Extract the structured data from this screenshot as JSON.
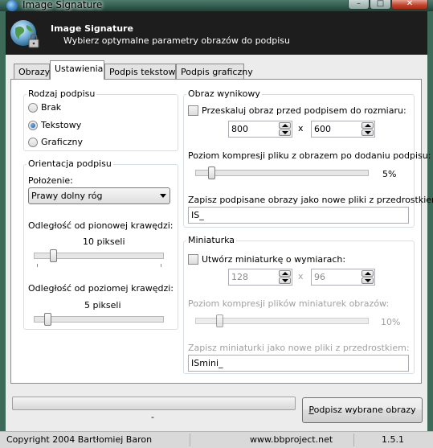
{
  "window": {
    "title": "Image Signature",
    "minimize_glyph": "–",
    "maximize_glyph": "□",
    "close_glyph": "✕"
  },
  "header": {
    "title": "Image Signature",
    "subtitle": "Wybierz optymalne parametry obrazów do podpisu",
    "logo_icon": "globe-lock-icon"
  },
  "tabs": [
    {
      "label": "Obrazy",
      "active": false
    },
    {
      "label": "Ustawienia",
      "active": true
    },
    {
      "label": "Podpis tekstowy",
      "active": false
    },
    {
      "label": "Podpis graficzny",
      "active": false
    }
  ],
  "signature_type": {
    "legend": "Rodzaj podpisu",
    "options": [
      "Brak",
      "Tekstowy",
      "Graficzny"
    ],
    "selected": "Tekstowy"
  },
  "orientation": {
    "legend": "Orientacja podpisu",
    "position_label": "Położenie:",
    "position_value": "Prawy dolny róg",
    "vertical_label": "Odległość od pionowej krawędzi:",
    "vertical_value": "10 pikseli",
    "vertical_level": 0.1,
    "horizontal_label": "Odległość od poziomej krawędzi:",
    "horizontal_value": "5 pikseli",
    "horizontal_level": 0.05
  },
  "output_image": {
    "legend": "Obraz wynikowy",
    "resize_label": "Przeskaluj obraz przed podpisem do rozmiaru:",
    "resize_checked": false,
    "width": "800",
    "x_separator": "x",
    "height": "600",
    "compression_label": "Poziom kompresji pliku z obrazem po dodaniu podpisu:",
    "compression_value": "5%",
    "compression_level": 0.05,
    "prefix_label": "Zapisz podpisane obrazy jako nowe pliki z przedrostkiem:",
    "prefix_value": "IS_"
  },
  "thumbnail": {
    "legend": "Miniaturka",
    "create_label": "Utwórz miniaturkę o wymiarach:",
    "create_checked": false,
    "width": "128",
    "x_separator": "x",
    "height": "96",
    "compression_label": "Poziom kompresji plików miniaturek obrazów:",
    "compression_value": "10%",
    "compression_level": 0.1,
    "prefix_label": "Zapisz miniaturki jako nowe pliki z przedrostkiem:",
    "prefix_value": "ISmini_"
  },
  "progress": {
    "status_text": "-",
    "level": 0
  },
  "sign_button": {
    "label_accel": "P",
    "label_rest": "odpisz wybrane obrazy"
  },
  "statusbar": {
    "copyright": "Copyright 2004 Bartłomiej Baron",
    "website": "www.bbproject.net",
    "version": "1.5.1"
  }
}
